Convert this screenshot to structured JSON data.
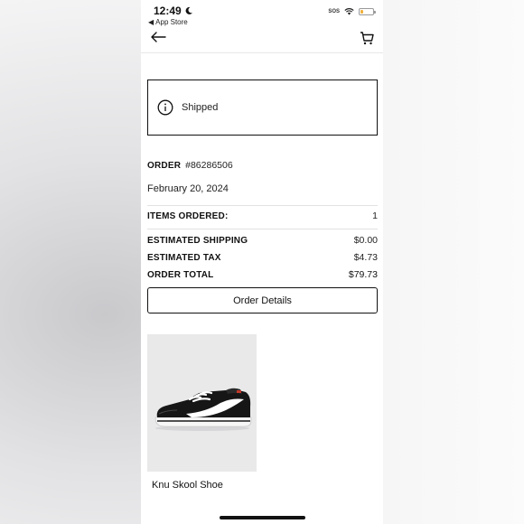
{
  "status_bar": {
    "time": "12:49",
    "back_app": "App Store",
    "sos": "SOS",
    "battery_level": 0.2,
    "battery_color": "#f2b13c"
  },
  "nav": {
    "back_icon": "arrow-left-icon",
    "cart_icon": "cart-icon"
  },
  "status_card": {
    "icon": "info-icon",
    "text": "Shipped"
  },
  "order": {
    "label": "ORDER",
    "number": "#86286506",
    "date": "February 20, 2024"
  },
  "summary": {
    "items_ordered_label": "ITEMS ORDERED:",
    "items_ordered_value": "1",
    "shipping_label": "ESTIMATED SHIPPING",
    "shipping_value": "$0.00",
    "tax_label": "ESTIMATED TAX",
    "tax_value": "$4.73",
    "total_label": "ORDER TOTAL",
    "total_value": "$79.73"
  },
  "order_details_button": "Order Details",
  "products": [
    {
      "name": "Knu Skool Shoe"
    }
  ]
}
